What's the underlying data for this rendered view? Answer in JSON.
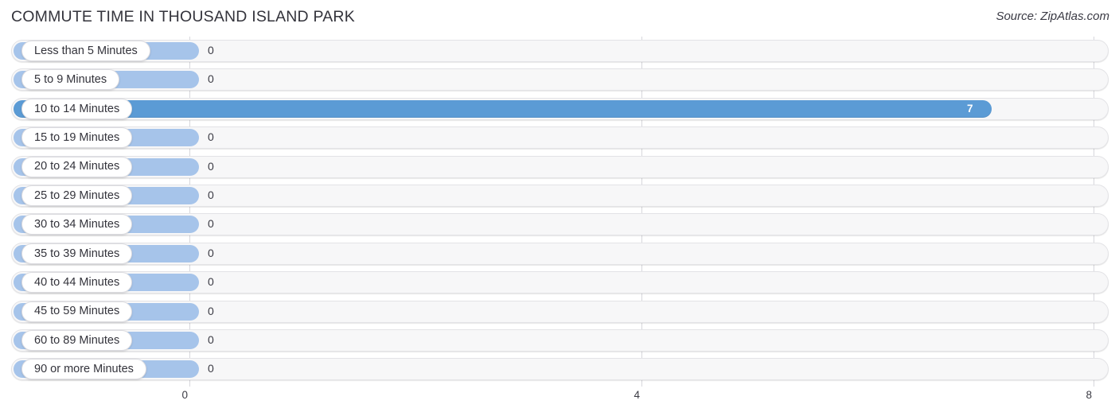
{
  "header": {
    "title": "COMMUTE TIME IN THOUSAND ISLAND PARK",
    "source": "Source: ZipAtlas.com"
  },
  "colors": {
    "bar_fill": "#5b9bd5",
    "capsule_light": "#a6c4ea",
    "track_bg": "#f7f7f8",
    "track_border": "#e3e3e6",
    "gridline": "#d7d7dc",
    "text": "#33333b"
  },
  "chart_data": {
    "type": "bar",
    "orientation": "horizontal",
    "title": "COMMUTE TIME IN THOUSAND ISLAND PARK",
    "subtitle": "",
    "xlabel": "",
    "ylabel": "",
    "source": "Source: ZipAtlas.com",
    "grid": true,
    "legend": false,
    "xlim": [
      0,
      8
    ],
    "xticks": [
      0,
      4,
      8
    ],
    "xtick_labels": [
      "0",
      "4",
      "8"
    ],
    "categories": [
      "Less than 5 Minutes",
      "5 to 9 Minutes",
      "10 to 14 Minutes",
      "15 to 19 Minutes",
      "20 to 24 Minutes",
      "25 to 29 Minutes",
      "30 to 34 Minutes",
      "35 to 39 Minutes",
      "40 to 44 Minutes",
      "45 to 59 Minutes",
      "60 to 89 Minutes",
      "90 or more Minutes"
    ],
    "values": [
      0,
      0,
      7,
      0,
      0,
      0,
      0,
      0,
      0,
      0,
      0,
      0
    ],
    "value_labels": [
      "0",
      "0",
      "7",
      "0",
      "0",
      "0",
      "0",
      "0",
      "0",
      "0",
      "0",
      "0"
    ]
  }
}
